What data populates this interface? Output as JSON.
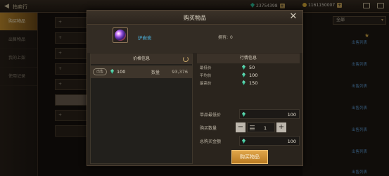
{
  "topbar": {
    "title": "拍卖行",
    "currency1": "23754398",
    "currency2": "1161150007"
  },
  "leftnav": {
    "items": [
      "购买物品",
      "出售物品",
      "我的上架",
      "使用记录"
    ]
  },
  "rightpanel": {
    "dropdown": "全部",
    "sell_list_label": "出售列表"
  },
  "modal": {
    "title": "购买物品",
    "item": {
      "name": "炉岩炭",
      "owned_label": "拥有:",
      "owned_value": "0"
    },
    "price_info": {
      "header": "价格信息",
      "rows": [
        {
          "tag": "出售",
          "price": "100",
          "qty_label": "数量",
          "qty": "93,376"
        }
      ]
    },
    "market_info": {
      "header": "行情信息",
      "rows": [
        {
          "label": "最低价",
          "value": "50"
        },
        {
          "label": "平均价",
          "value": "100"
        },
        {
          "label": "最高价",
          "value": "150"
        }
      ]
    },
    "form": {
      "unit_low_label": "单品最低价",
      "unit_low_value": "100",
      "qty_label": "购买数量",
      "qty_value": "1",
      "total_label": "总购买金额",
      "total_value": "100"
    },
    "buy_button": "购买物品"
  },
  "colors": {
    "accent": "#c9922e",
    "gem": "#2fc9a0",
    "item_name": "#4cb8e6"
  }
}
